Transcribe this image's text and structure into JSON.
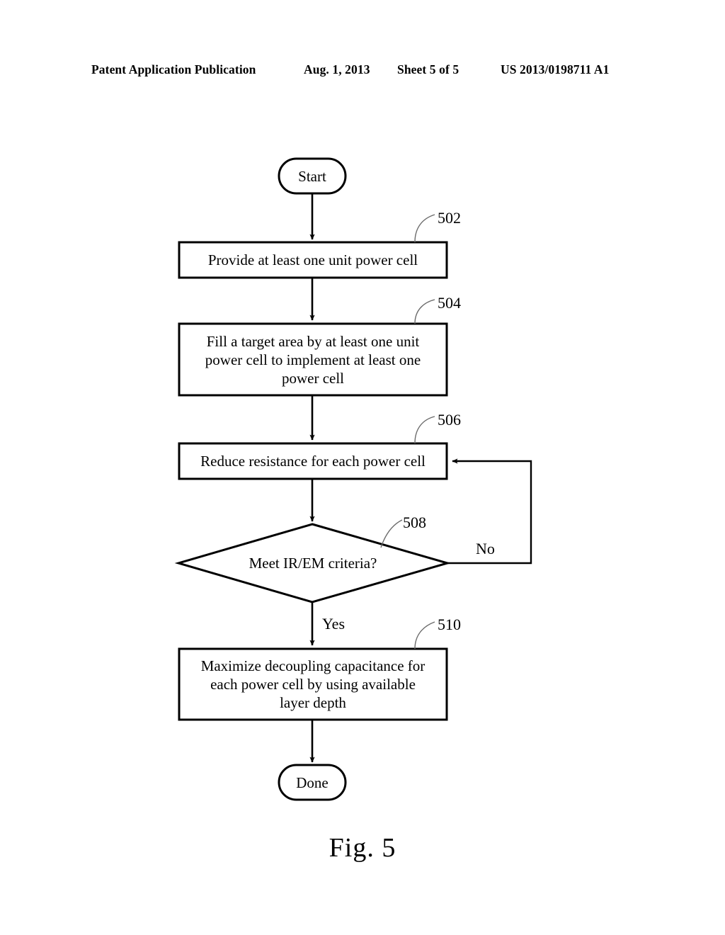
{
  "header": {
    "publication": "Patent Application Publication",
    "date": "Aug. 1, 2013",
    "sheet": "Sheet 5 of 5",
    "patent_number": "US 2013/0198711 A1"
  },
  "figure": {
    "caption": "Fig.  5",
    "line_color": "#000000",
    "leader_color": "#6b6b6b",
    "fill_color": "#ffffff"
  },
  "flowchart": {
    "nodes": {
      "start": {
        "label": "Start",
        "shape": "terminator"
      },
      "step_502": {
        "ref": "502",
        "shape": "process",
        "lines": [
          "Provide at least one unit power cell"
        ]
      },
      "step_504": {
        "ref": "504",
        "shape": "process",
        "lines": [
          "Fill a target area by at least one unit",
          "power cell to implement at least one",
          "power cell"
        ]
      },
      "step_506": {
        "ref": "506",
        "shape": "process",
        "lines": [
          "Reduce resistance for each power cell"
        ]
      },
      "step_508": {
        "ref": "508",
        "shape": "decision",
        "lines": [
          "Meet IR/EM criteria?"
        ]
      },
      "step_510": {
        "ref": "510",
        "shape": "process",
        "lines": [
          "Maximize decoupling capacitance for",
          "each power cell by using available",
          "layer depth"
        ]
      },
      "done": {
        "label": "Done",
        "shape": "terminator"
      }
    },
    "branches": {
      "no": "No",
      "yes": "Yes"
    }
  }
}
